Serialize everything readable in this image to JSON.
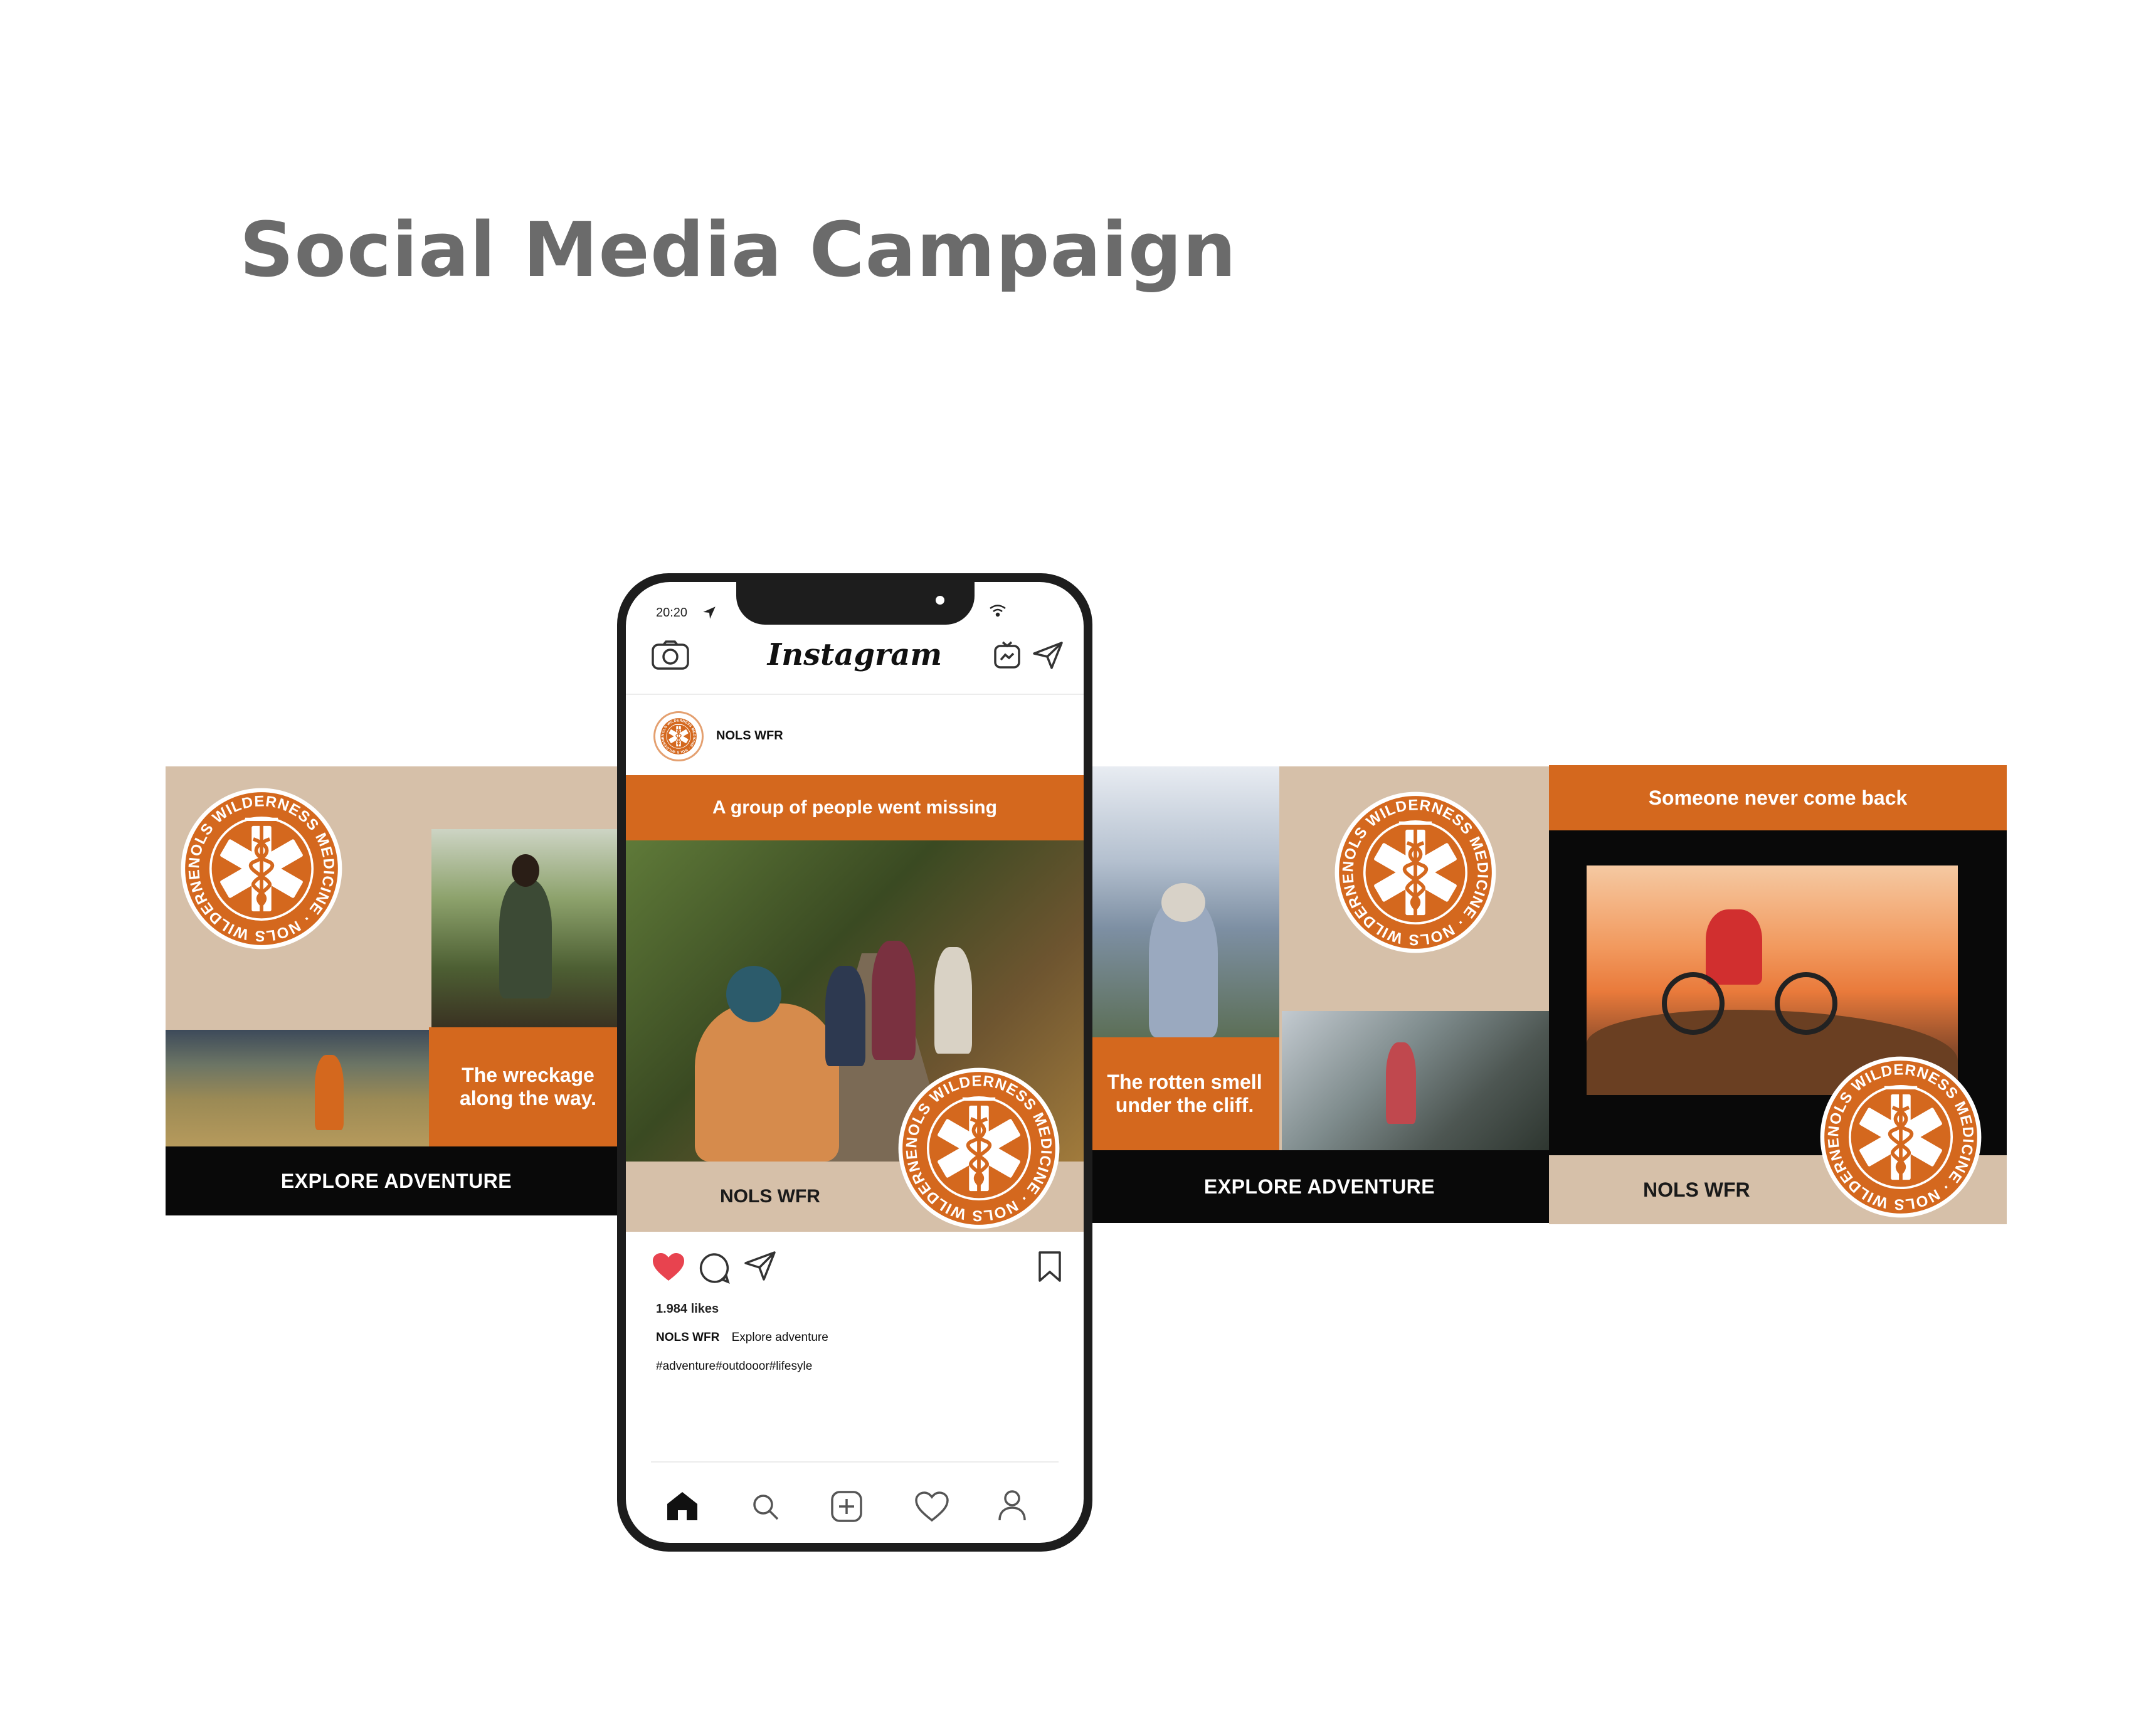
{
  "page": {
    "title": "Social Media Campaign"
  },
  "colors": {
    "orange": "#d4681e",
    "beige": "#d6c0a9",
    "black": "#090909",
    "heart": "#e8434f"
  },
  "logo": {
    "text": "NOLS WILDERNESS MEDICINE"
  },
  "panels": {
    "left": {
      "caption": "The wreckage along the way.",
      "footer": "EXPLORE ADVENTURE"
    },
    "center_post": {
      "header": "A group of people went missing",
      "footer": "NOLS WFR"
    },
    "right1": {
      "caption": "The rotten smell under the cliff.",
      "footer": "EXPLORE ADVENTURE"
    },
    "right2": {
      "header": "Someone never come back",
      "footer": "NOLS WFR"
    }
  },
  "phone": {
    "status": {
      "time": "20:20",
      "location_icon": "location-arrow-icon",
      "wifi_icon": "wifi-icon"
    },
    "app": {
      "name": "Instagram",
      "icons": [
        "camera-icon",
        "igtv-icon",
        "send-icon"
      ]
    },
    "post": {
      "account": "NOLS WFR",
      "likes": "1.984 likes",
      "caption_user": "NOLS WFR",
      "caption_text": "Explore adventure",
      "hashtags": "#adventure#outdooor#lifesyle",
      "actions": [
        "heart-icon",
        "comment-icon",
        "share-icon",
        "bookmark-icon"
      ]
    },
    "nav": [
      "home-icon",
      "search-icon",
      "add-post-icon",
      "activity-icon",
      "profile-icon"
    ]
  }
}
